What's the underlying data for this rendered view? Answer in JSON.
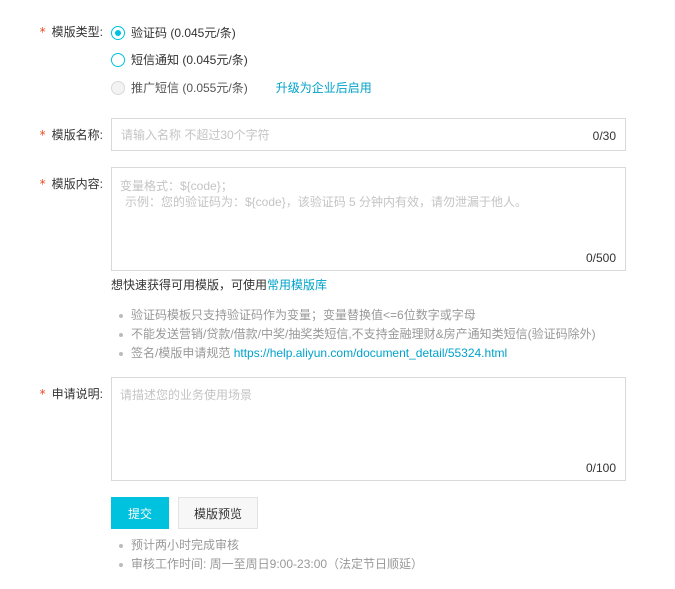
{
  "template_type": {
    "label": "模版类型:",
    "options": [
      {
        "label": "验证码 (0.045元/条)",
        "checked": true,
        "disabled": false
      },
      {
        "label": "短信通知 (0.045元/条)",
        "checked": false,
        "disabled": false
      },
      {
        "label": "推广短信 (0.055元/条)",
        "checked": false,
        "disabled": true
      }
    ],
    "upgrade_link": "升级为企业后启用"
  },
  "template_name": {
    "label": "模版名称:",
    "placeholder": "请输入名称 不超过30个字符",
    "counter": "0/30"
  },
  "template_content": {
    "label": "模版内容:",
    "placeholder_line1": "变量格式：${code}；",
    "placeholder_line2": "示例：您的验证码为：${code}，该验证码 5 分钟内有效，请勿泄漏于他人。",
    "counter": "0/500",
    "hint_text": "想快速获得可用模版，可使用",
    "hint_link": "常用模版库",
    "notes": [
      "验证码模板只支持验证码作为变量；变量替换值<=6位数字或字母",
      "不能发送营销/贷款/借款/中奖/抽奖类短信,不支持金融理财&房产通知类短信(验证码除外)"
    ],
    "spec_prefix": "签名/模版申请规范",
    "spec_link": "https://help.aliyun.com/document_detail/55324.html"
  },
  "application_note": {
    "label": "申请说明:",
    "placeholder": "请描述您的业务使用场景",
    "counter": "0/100"
  },
  "actions": {
    "submit": "提交",
    "preview": "模版预览"
  },
  "footer_notes": [
    "预计两小时完成审核",
    "审核工作时间: 周一至周日9:00-23:00（法定节日顺延）"
  ],
  "colors": {
    "accent": "#00c1de",
    "link": "#00a2ca",
    "required_star": "#f04a1e"
  }
}
